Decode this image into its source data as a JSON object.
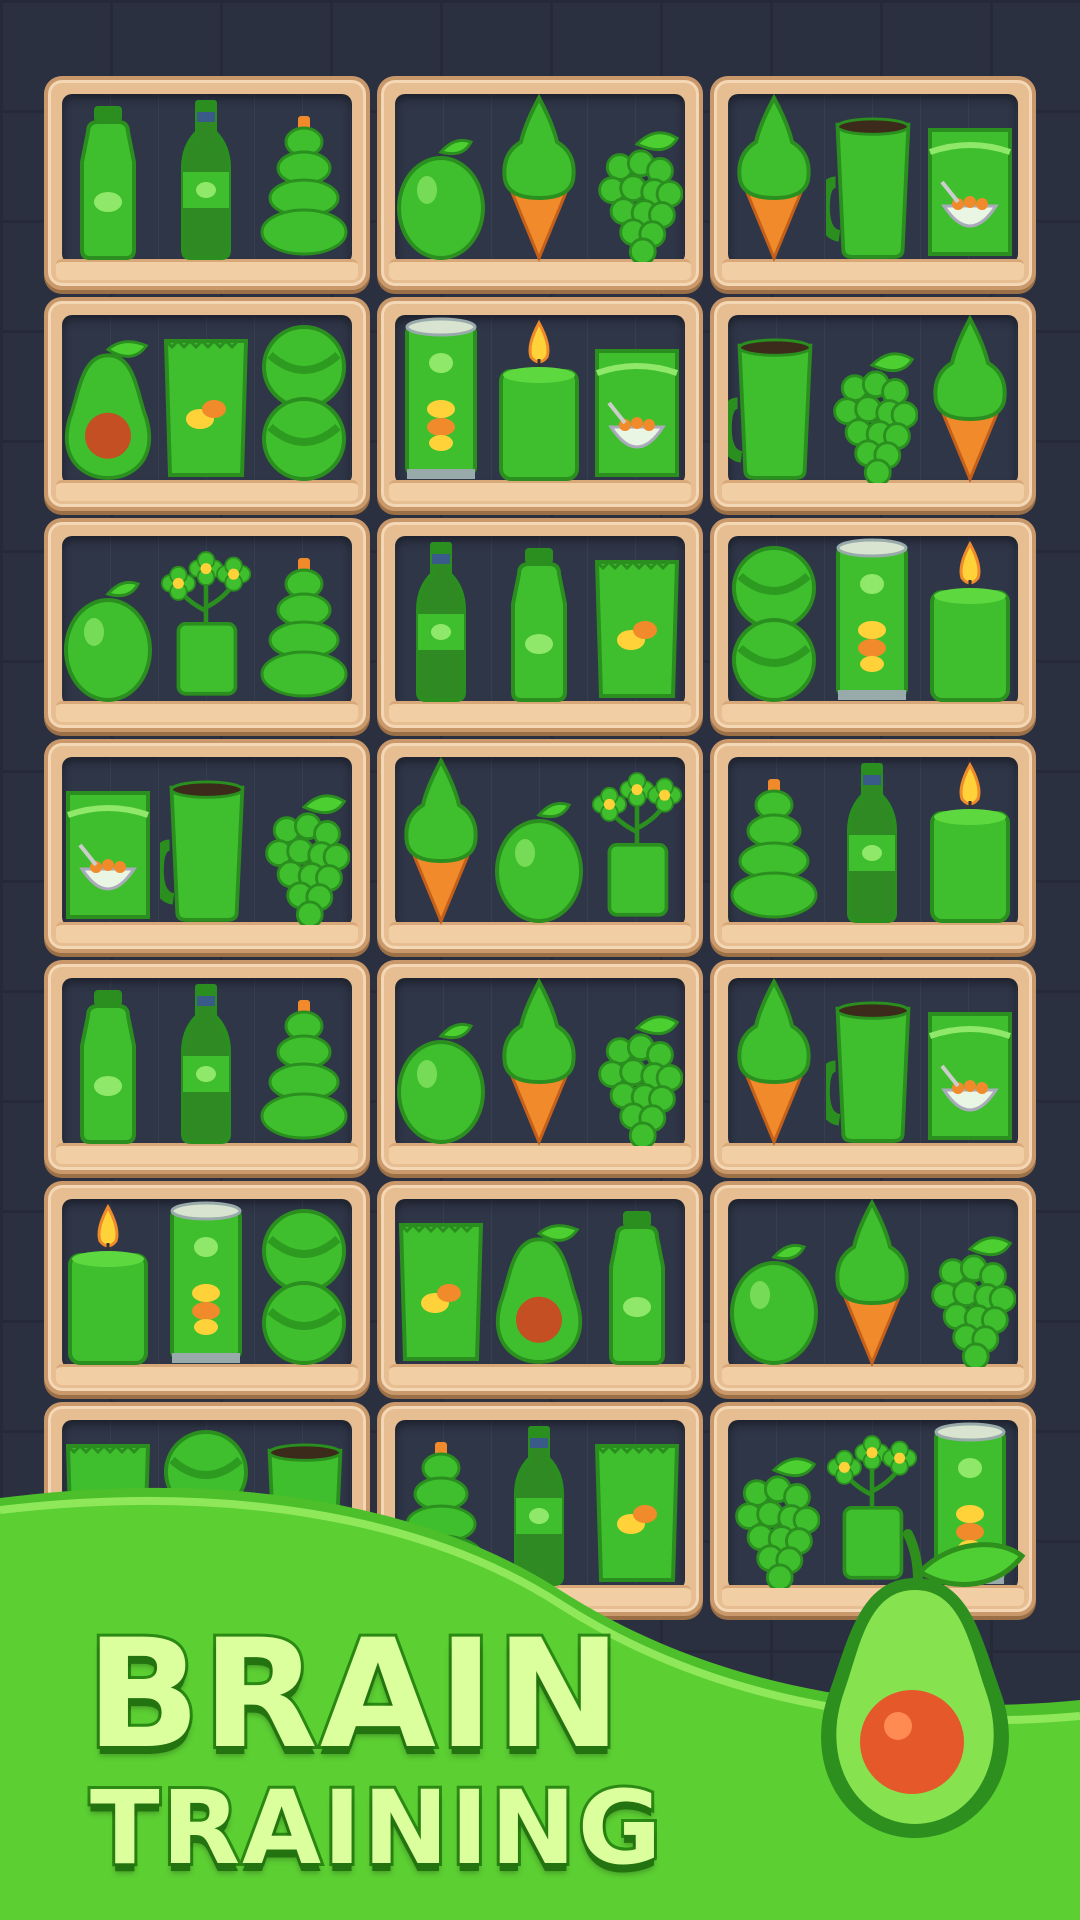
{
  "headline": {
    "line1": "BRAIN",
    "line2": "TRAINING"
  },
  "colors": {
    "item_green": "#3fbf2e",
    "item_dark_green": "#2a8f1f",
    "shelf_wood": "#e7bd92",
    "banner_green": "#5ccf33",
    "headline_fill": "#dcff9e",
    "headline_outline": "#2b8a13",
    "background": "#2b3040"
  },
  "shelves": [
    [
      "water-bottle",
      "soda-bottle",
      "ring-stacker"
    ],
    [
      "lime",
      "ice-cream-cone",
      "grapes"
    ],
    [
      "ice-cream-cone",
      "mug",
      "cereal-bag"
    ],
    [
      "avocado",
      "chips-bag",
      "ball-stack"
    ],
    [
      "chips-can",
      "candle",
      "cereal-bag"
    ],
    [
      "mug",
      "grapes",
      "ice-cream-cone"
    ],
    [
      "lime",
      "potted-plant",
      "ring-stacker"
    ],
    [
      "soda-bottle",
      "water-bottle",
      "chips-bag"
    ],
    [
      "ball-stack",
      "chips-can",
      "candle"
    ],
    [
      "cereal-bag",
      "mug",
      "grapes"
    ],
    [
      "ice-cream-cone",
      "lime",
      "potted-plant"
    ],
    [
      "ring-stacker",
      "soda-bottle",
      "candle"
    ],
    [
      "water-bottle",
      "soda-bottle",
      "ring-stacker"
    ],
    [
      "lime",
      "ice-cream-cone",
      "grapes"
    ],
    [
      "ice-cream-cone",
      "mug",
      "cereal-bag"
    ],
    [
      "candle",
      "chips-can",
      "ball-stack"
    ],
    [
      "chips-bag",
      "avocado",
      "water-bottle"
    ],
    [
      "lime",
      "ice-cream-cone",
      "grapes"
    ],
    [
      "chips-bag",
      "ball-stack",
      "mug"
    ],
    [
      "ring-stacker",
      "soda-bottle",
      "chips-bag"
    ],
    [
      "grapes",
      "potted-plant",
      "chips-can"
    ]
  ],
  "mascot": "avocado"
}
